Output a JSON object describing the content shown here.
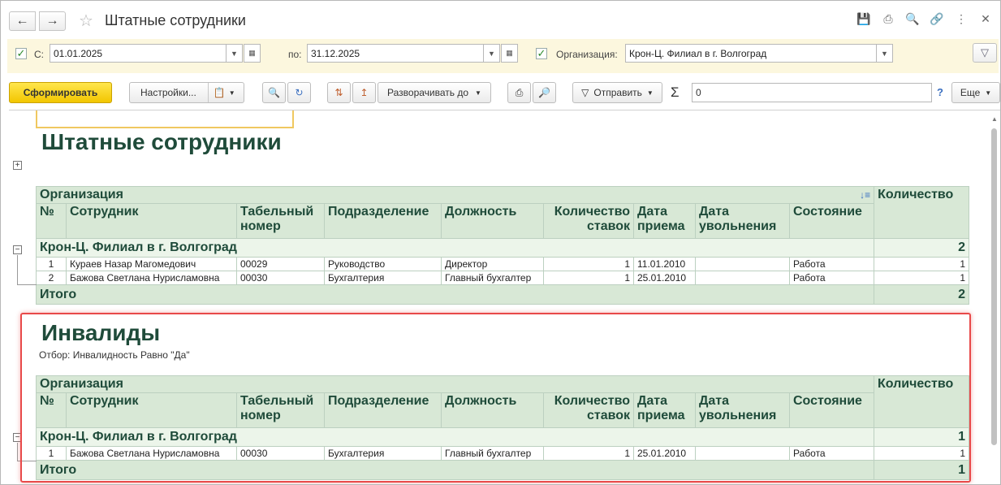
{
  "window": {
    "title": "Штатные сотрудники",
    "back_icon": "arrow-left-icon",
    "forward_icon": "arrow-right-icon",
    "favorite_icon": "star-icon",
    "header_icons": [
      "save-icon",
      "print-icon",
      "preview-icon",
      "link-icon",
      "more-icon",
      "close-icon"
    ]
  },
  "filters": {
    "from_label": "С:",
    "from_value": "01.01.2025",
    "to_label": "по:",
    "to_value": "31.12.2025",
    "org_label": "Организация:",
    "org_value": "Крон-Ц. Филиал в г. Волгоград",
    "from_checked": true,
    "org_checked": true
  },
  "toolbar": {
    "generate_label": "Сформировать",
    "settings_label": "Настройки...",
    "expand_label": "Разворачивать до",
    "send_label": "Отправить",
    "sum_value": "0",
    "help_label": "?",
    "more_label": "Еще"
  },
  "report1": {
    "title": "Штатные сотрудники",
    "org_header": "Организация",
    "count_header": "Количество",
    "columns": [
      "№",
      "Сотрудник",
      "Табельный номер",
      "Подразделение",
      "Должность",
      "Количество ставок",
      "Дата приема",
      "Дата увольнения",
      "Состояние"
    ],
    "col_tab1": "Табельный",
    "col_tab2": "номер",
    "col_rate1": "Количество",
    "col_rate2": "ставок",
    "col_hire1": "Дата",
    "col_hire2": "приема",
    "col_fire1": "Дата",
    "col_fire2": "увольнения",
    "group_name": "Крон-Ц. Филиал в г. Волгоград",
    "group_count": "2",
    "rows": [
      {
        "n": "1",
        "name": "Кураев Назар Магомедович",
        "tab": "00029",
        "dept": "Руководство",
        "pos": "Директор",
        "rate": "1",
        "hire": "11.01.2010",
        "fire": "",
        "state": "Работа",
        "count": "1"
      },
      {
        "n": "2",
        "name": "Бажова Светлана Нурисламовна",
        "tab": "00030",
        "dept": "Бухгалтерия",
        "pos": "Главный бухгалтер",
        "rate": "1",
        "hire": "25.01.2010",
        "fire": "",
        "state": "Работа",
        "count": "1"
      }
    ],
    "total_label": "Итого",
    "total_count": "2"
  },
  "report2": {
    "title": "Инвалиды",
    "filter_text": "Отбор: Инвалидность Равно \"Да\"",
    "org_header": "Организация",
    "count_header": "Количество",
    "group_name": "Крон-Ц. Филиал в г. Волгоград",
    "group_count": "1",
    "rows": [
      {
        "n": "1",
        "name": "Бажова Светлана Нурисламовна",
        "tab": "00030",
        "dept": "Бухгалтерия",
        "pos": "Главный бухгалтер",
        "rate": "1",
        "hire": "25.01.2010",
        "fire": "",
        "state": "Работа",
        "count": "1"
      }
    ],
    "total_label": "Итого",
    "total_count": "1"
  },
  "colors": {
    "accent_yellow": "#f2c600",
    "header_green": "#d8e8d6",
    "title_green": "#1f4b3a",
    "highlight_red": "#e84a4a",
    "filter_bg": "#fcf7de"
  }
}
